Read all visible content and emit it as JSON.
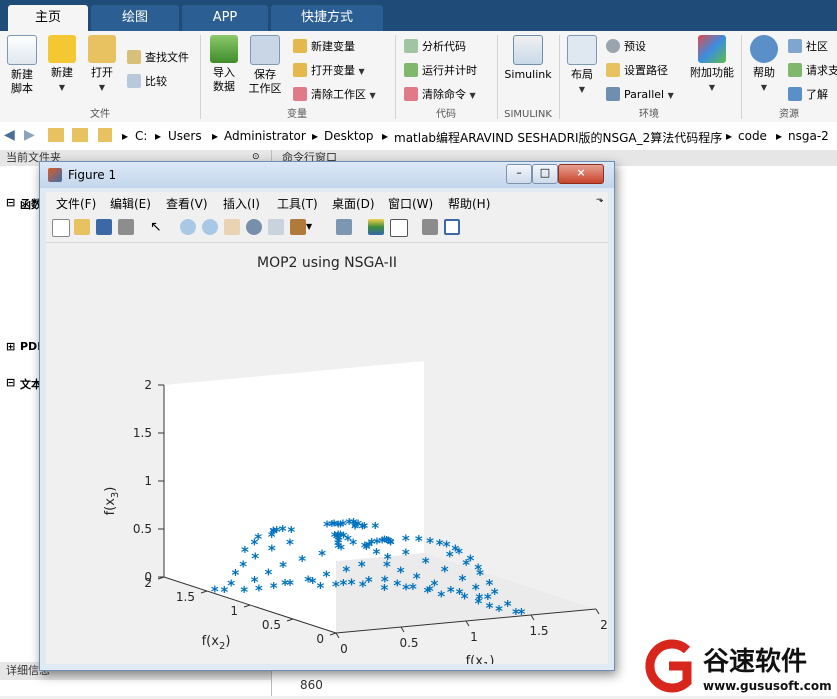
{
  "tabs": [
    "主页",
    "绘图",
    "APP",
    "快捷方式"
  ],
  "ribbon": {
    "file": {
      "new_script": "新建\n脚本",
      "new": "新建",
      "open": "打开",
      "find_files": "查找文件",
      "compare": "比较",
      "group": "文件"
    },
    "variable": {
      "import_data": "导入\n数据",
      "save_workspace": "保存\n工作区",
      "new_variable": "新建变量",
      "open_variable": "打开变量",
      "clear_workspace": "清除工作区",
      "group": "变量"
    },
    "code": {
      "analyze": "分析代码",
      "run_time": "运行并计时",
      "clear_commands": "清除命令",
      "group": "代码"
    },
    "simulink": {
      "label": "Simulink",
      "group": "SIMULINK"
    },
    "environment": {
      "layout": "布局",
      "preferences": "预设",
      "set_path": "设置路径",
      "parallel": "Parallel",
      "addons": "附加功能",
      "group": "环境"
    },
    "resources": {
      "help": "帮助",
      "community": "社区",
      "request_support": "请求支",
      "learn": "了解",
      "group": "资源"
    }
  },
  "address": {
    "path": [
      "C:",
      "Users",
      "Administrator",
      "Desktop",
      "matlab编程ARAVIND SESHADRI版的NSGA_2算法代码程序",
      "code",
      "nsga-2"
    ]
  },
  "left_pane": {
    "header": "当前文件夹",
    "sections": [
      "函数",
      "PDF",
      "文本"
    ],
    "footer": "详细信息"
  },
  "right_pane": {
    "header": "命令行窗口",
    "bottom_value": "860"
  },
  "figure": {
    "title": "Figure 1",
    "menu": [
      "文件(F)",
      "编辑(E)",
      "查看(V)",
      "插入(I)",
      "工具(T)",
      "桌面(D)",
      "窗口(W)",
      "帮助(H)"
    ],
    "window_buttons": [
      "–",
      "□",
      "×"
    ]
  },
  "chart_data": {
    "type": "scatter",
    "title": "MOP2 using NSGA-II",
    "xlabel": "f(x_1)",
    "ylabel": "f(x_2)",
    "zlabel": "f(x_3)",
    "xlim": [
      0,
      2
    ],
    "ylim": [
      0,
      2
    ],
    "zlim": [
      0,
      2
    ],
    "xticks": [
      "0",
      "0.5",
      "1",
      "1.5",
      "2"
    ],
    "yticks": [
      "0",
      "0.5",
      "1",
      "1.5",
      "2"
    ],
    "zticks": [
      "0",
      "0.5",
      "1",
      "1.5",
      "2"
    ],
    "marker": "*",
    "color": "#0072bd",
    "points": [
      [
        0.92,
        0.92,
        0.45
      ],
      [
        0.85,
        0.95,
        0.52
      ],
      [
        0.98,
        0.88,
        0.4
      ],
      [
        0.78,
        0.98,
        0.55
      ],
      [
        0.95,
        0.8,
        0.58
      ],
      [
        0.7,
        0.92,
        0.62
      ],
      [
        0.88,
        0.7,
        0.63
      ],
      [
        0.62,
        0.85,
        0.68
      ],
      [
        0.8,
        0.6,
        0.68
      ],
      [
        0.55,
        0.78,
        0.72
      ],
      [
        0.72,
        0.5,
        0.72
      ],
      [
        0.48,
        0.7,
        0.75
      ],
      [
        0.65,
        0.42,
        0.76
      ],
      [
        0.4,
        0.62,
        0.78
      ],
      [
        0.58,
        0.34,
        0.78
      ],
      [
        0.35,
        0.52,
        0.8
      ],
      [
        0.5,
        0.28,
        0.8
      ],
      [
        0.3,
        0.42,
        0.82
      ],
      [
        0.42,
        0.22,
        0.82
      ],
      [
        0.25,
        0.35,
        0.82
      ],
      [
        0.36,
        0.16,
        0.82
      ],
      [
        0.2,
        0.28,
        0.82
      ],
      [
        0.3,
        0.1,
        0.82
      ],
      [
        0.15,
        0.2,
        0.82
      ],
      [
        1.02,
        0.95,
        0.3
      ],
      [
        1.08,
        0.88,
        0.25
      ],
      [
        0.9,
        1.06,
        0.28
      ],
      [
        1.15,
        0.8,
        0.2
      ],
      [
        0.82,
        1.12,
        0.22
      ],
      [
        1.22,
        0.7,
        0.15
      ],
      [
        0.72,
        1.2,
        0.16
      ],
      [
        1.28,
        0.6,
        0.1
      ],
      [
        0.62,
        1.26,
        0.1
      ],
      [
        1.32,
        0.5,
        0.06
      ],
      [
        0.52,
        1.32,
        0.06
      ],
      [
        1.36,
        0.4,
        0.03
      ],
      [
        0.42,
        1.36,
        0.03
      ],
      [
        1.38,
        0.3,
        0.01
      ],
      [
        0.32,
        1.38,
        0.01
      ],
      [
        1.4,
        0.22,
        0.0
      ],
      [
        0.22,
        1.4,
        0.0
      ],
      [
        1.05,
        1.02,
        0.12
      ],
      [
        1.12,
        0.98,
        0.08
      ],
      [
        0.98,
        1.1,
        0.1
      ],
      [
        1.2,
        0.92,
        0.05
      ],
      [
        0.9,
        1.18,
        0.06
      ],
      [
        1.26,
        0.84,
        0.03
      ],
      [
        0.82,
        1.24,
        0.03
      ],
      [
        1.3,
        0.74,
        0.01
      ],
      [
        0.74,
        1.3,
        0.01
      ],
      [
        1.0,
        0.7,
        0.5
      ],
      [
        0.7,
        1.0,
        0.5
      ],
      [
        1.1,
        0.62,
        0.42
      ],
      [
        0.62,
        1.1,
        0.42
      ],
      [
        1.18,
        0.52,
        0.35
      ],
      [
        0.52,
        1.18,
        0.35
      ],
      [
        1.25,
        0.42,
        0.28
      ],
      [
        0.42,
        1.25,
        0.28
      ],
      [
        1.3,
        0.34,
        0.2
      ],
      [
        0.34,
        1.3,
        0.2
      ],
      [
        1.34,
        0.26,
        0.12
      ],
      [
        0.26,
        1.34,
        0.12
      ],
      [
        1.14,
        0.4,
        0.55
      ],
      [
        0.4,
        1.14,
        0.55
      ],
      [
        1.2,
        0.3,
        0.48
      ],
      [
        0.3,
        1.2,
        0.48
      ],
      [
        1.24,
        0.2,
        0.4
      ],
      [
        0.2,
        1.24,
        0.4
      ],
      [
        1.26,
        0.12,
        0.32
      ],
      [
        0.12,
        1.26,
        0.32
      ],
      [
        1.26,
        0.06,
        0.24
      ],
      [
        0.06,
        1.26,
        0.24
      ],
      [
        1.05,
        0.2,
        0.68
      ],
      [
        0.2,
        1.05,
        0.68
      ],
      [
        1.1,
        0.1,
        0.6
      ],
      [
        0.1,
        1.1,
        0.6
      ],
      [
        1.12,
        0.04,
        0.52
      ],
      [
        0.04,
        1.12,
        0.52
      ],
      [
        0.95,
        0.15,
        0.75
      ],
      [
        0.15,
        0.95,
        0.75
      ],
      [
        0.98,
        0.05,
        0.7
      ],
      [
        0.05,
        0.98,
        0.7
      ],
      [
        0.85,
        0.08,
        0.8
      ],
      [
        0.08,
        0.85,
        0.8
      ],
      [
        0.75,
        0.04,
        0.84
      ],
      [
        0.04,
        0.75,
        0.84
      ],
      [
        0.65,
        0.02,
        0.88
      ],
      [
        0.02,
        0.65,
        0.88
      ],
      [
        0.55,
        0.02,
        0.9
      ],
      [
        0.02,
        0.55,
        0.9
      ],
      [
        1.45,
        0.1,
        0.0
      ],
      [
        0.1,
        1.45,
        0.0
      ],
      [
        1.44,
        0.02,
        0.02
      ],
      [
        0.02,
        1.44,
        0.02
      ],
      [
        1.4,
        0.12,
        0.08
      ],
      [
        0.12,
        1.4,
        0.08
      ],
      [
        0.6,
        0.6,
        0.85
      ],
      [
        0.5,
        0.5,
        0.92
      ],
      [
        0.45,
        0.6,
        0.9
      ],
      [
        0.6,
        0.45,
        0.9
      ],
      [
        0.4,
        0.4,
        0.98
      ],
      [
        0.3,
        0.3,
        1.02
      ],
      [
        0.35,
        0.2,
        1.0
      ],
      [
        0.2,
        0.35,
        1.0
      ],
      [
        0.25,
        0.15,
        1.04
      ],
      [
        0.15,
        0.25,
        1.04
      ],
      [
        0.1,
        0.1,
        1.08
      ],
      [
        0.05,
        0.18,
        1.06
      ],
      [
        0.18,
        0.05,
        1.06
      ],
      [
        0.05,
        0.05,
        1.1
      ],
      [
        1.5,
        0.6,
        0.0
      ],
      [
        0.6,
        1.5,
        0.0
      ],
      [
        1.48,
        0.8,
        0.0
      ],
      [
        0.8,
        1.48,
        0.0
      ],
      [
        1.1,
        1.1,
        0.0
      ],
      [
        1.0,
        1.2,
        0.02
      ],
      [
        1.2,
        1.0,
        0.02
      ],
      [
        1.35,
        0.95,
        0.0
      ],
      [
        0.95,
        1.35,
        0.0
      ]
    ]
  }
}
